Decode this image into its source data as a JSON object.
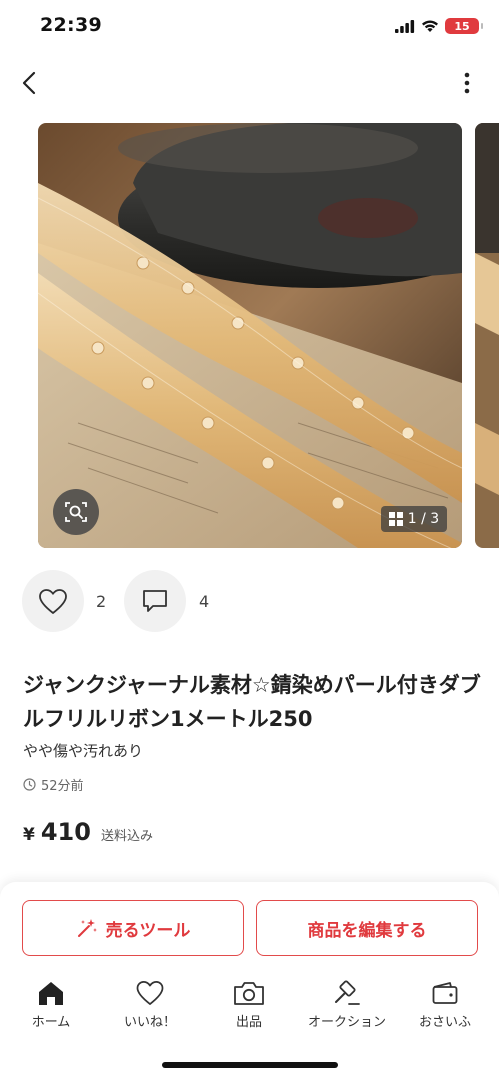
{
  "status_bar": {
    "time": "22:39",
    "battery": "15"
  },
  "nav": {
    "back_icon": "chevron-left-icon",
    "more_icon": "more-vertical-icon"
  },
  "gallery": {
    "counter": "1 / 3",
    "lens_icon": "image-search-icon"
  },
  "social": {
    "like_count": "2",
    "comment_count": "4"
  },
  "item": {
    "title": "ジャンクジャーナル素材☆錆染めパール付きダブルフリルリボン1メートル250",
    "condition": "やや傷や汚れあり",
    "posted": "52分前",
    "price_symbol": "¥",
    "price": "410",
    "shipping_note": "送料込み"
  },
  "actions": {
    "sell_tool": "売るツール",
    "edit_item": "商品を編集する"
  },
  "tabs": [
    {
      "label": "ホーム",
      "icon": "home-icon"
    },
    {
      "label": "いいね！",
      "icon": "heart-icon"
    },
    {
      "label": "出品",
      "icon": "camera-icon"
    },
    {
      "label": "オークション",
      "icon": "gavel-icon"
    },
    {
      "label": "おさいふ",
      "icon": "wallet-icon"
    }
  ],
  "colors": {
    "accent": "#e03a3e",
    "text": "#222222"
  }
}
